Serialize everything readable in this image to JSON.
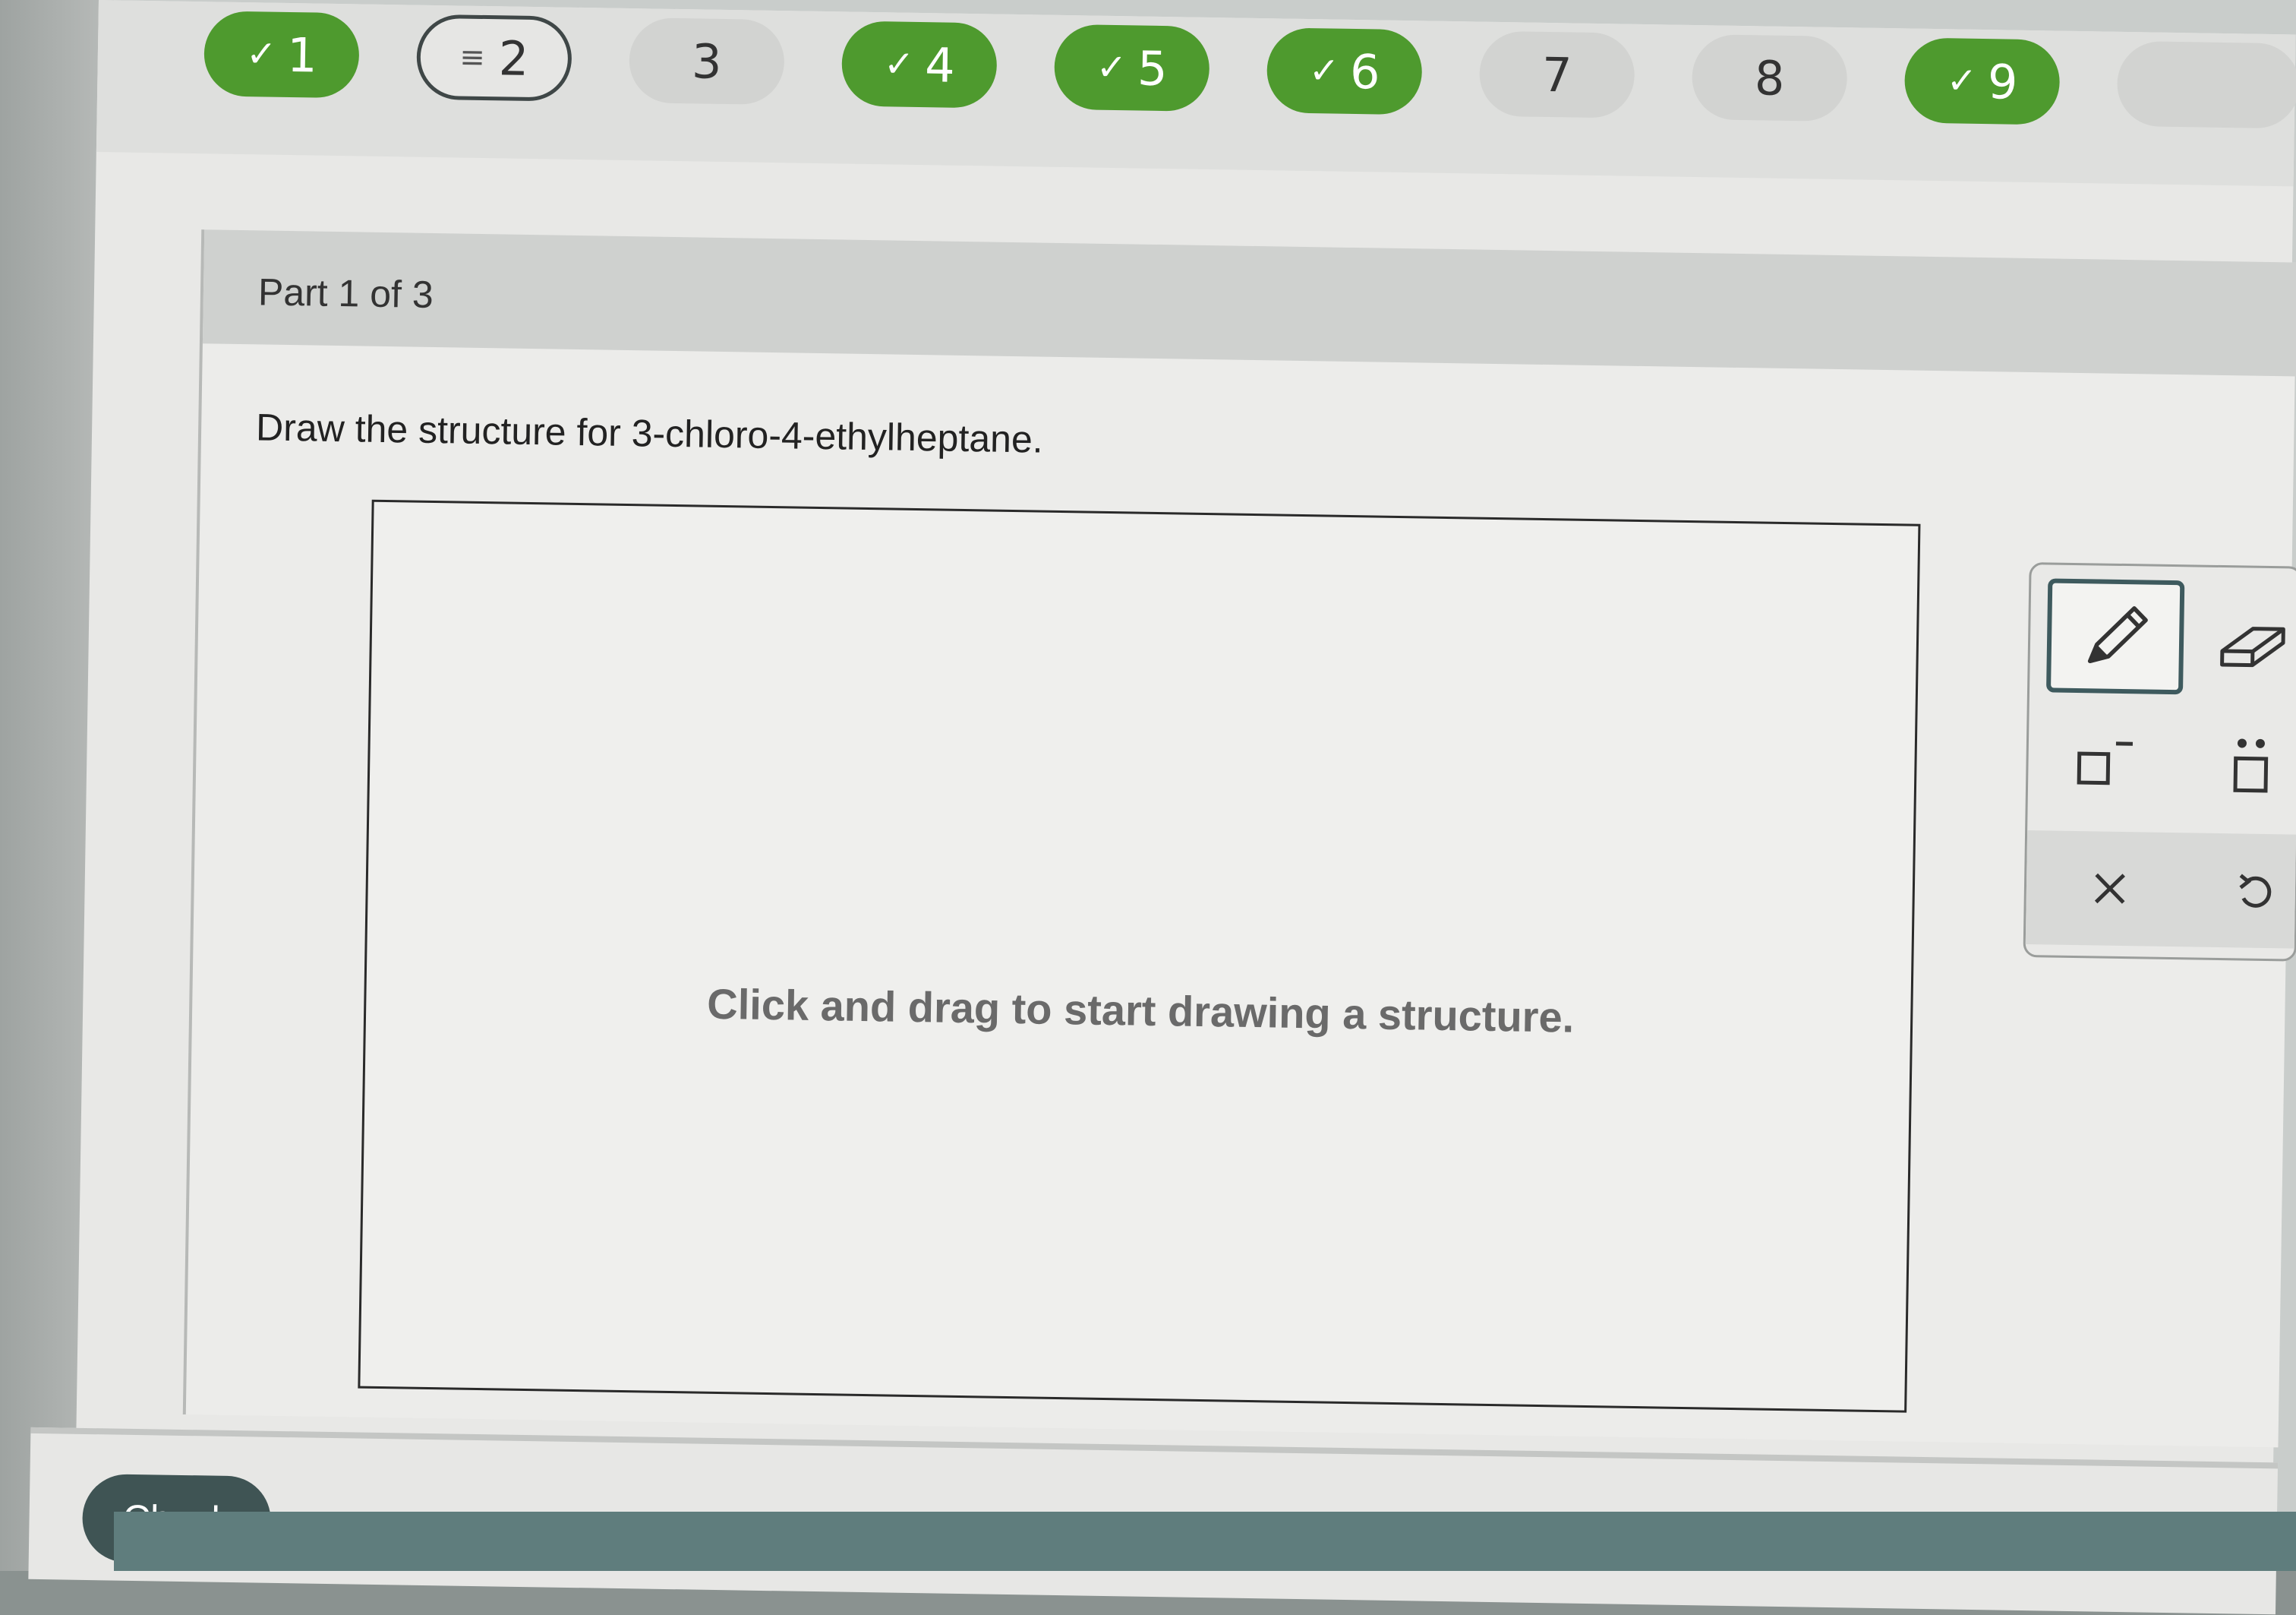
{
  "questions": [
    {
      "number": "1",
      "status": "done",
      "icon": "check-icon"
    },
    {
      "number": "2",
      "status": "current",
      "icon": "list-icon"
    },
    {
      "number": "3",
      "status": "pending"
    },
    {
      "number": "4",
      "status": "done",
      "icon": "check-icon"
    },
    {
      "number": "5",
      "status": "done",
      "icon": "check-icon"
    },
    {
      "number": "6",
      "status": "done",
      "icon": "check-icon"
    },
    {
      "number": "7",
      "status": "pending"
    },
    {
      "number": "8",
      "status": "pending"
    },
    {
      "number": "9",
      "status": "done",
      "icon": "check-icon"
    }
  ],
  "part": {
    "label": "Part 1 of 3"
  },
  "prompt": "Draw the structure for 3-chloro-4-ethylheptane.",
  "canvas": {
    "hint": "Click and drag to start drawing a structure."
  },
  "tools": [
    "pencil-icon",
    "eraser-icon",
    "charge-icon",
    "lone-pair-icon",
    "close-icon",
    "undo-icon"
  ],
  "footer": {
    "check_label": "Check"
  },
  "colors": {
    "done": "#4e9a2e",
    "check_button": "#3f5454",
    "selected_tool_border": "#3e5a5e"
  }
}
